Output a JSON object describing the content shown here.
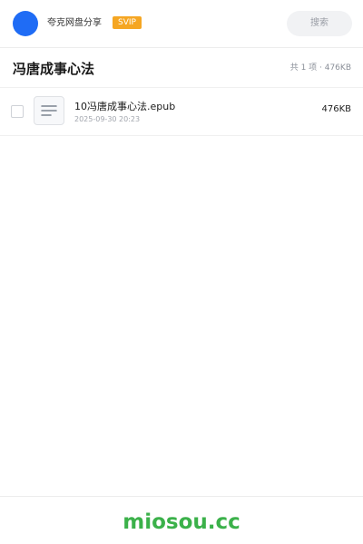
{
  "header": {
    "app_name": "夸克网盘分享",
    "badge": "SVIP",
    "search_label": "搜索",
    "colors": {
      "avatar": "#1f6cf5",
      "badge": "#f5a623"
    }
  },
  "folder": {
    "title": "冯唐成事心法",
    "summary": "共 1 项 · 476KB"
  },
  "files": [
    {
      "name": "10冯唐成事心法.epub",
      "time": "2025-09-30 20:23",
      "size": "476KB",
      "icon": "document-icon"
    }
  ],
  "footer": {
    "brand": "miosou.cc",
    "color": "#3bb14a"
  }
}
